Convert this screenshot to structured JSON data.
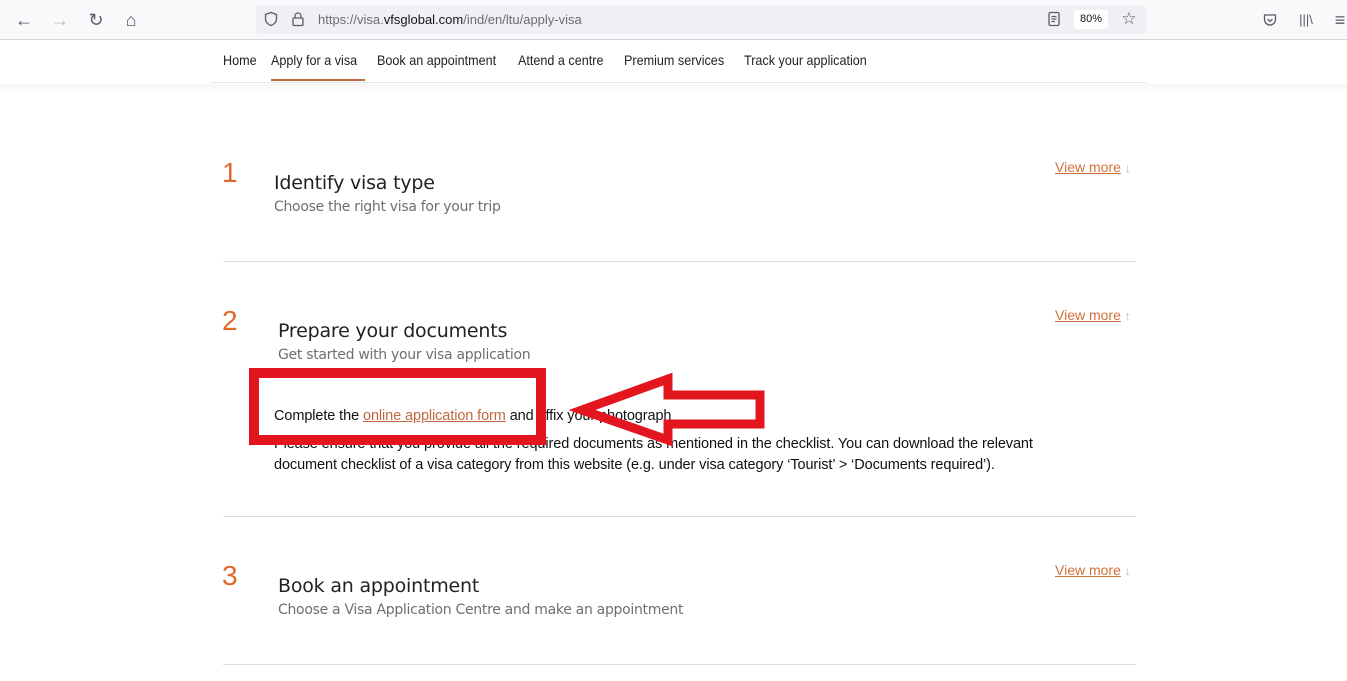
{
  "browser": {
    "url_prefix": "https://visa.",
    "url_domain": "vfsglobal.com",
    "url_path": "/ind/en/ltu/apply-visa",
    "zoom_level": "80%",
    "icons": {
      "back": "←",
      "forward": "→",
      "reload": "↻",
      "home": "⌂",
      "shield": "⛉",
      "lock": "🔒",
      "reader": "▤",
      "bookmark": "☆",
      "pocket": "⛉",
      "library": "|||\\",
      "menu": "≡"
    }
  },
  "nav": {
    "items": [
      {
        "label": "Home"
      },
      {
        "label": "Apply for a visa",
        "active": true
      },
      {
        "label": "Book an appointment"
      },
      {
        "label": "Attend a centre"
      },
      {
        "label": "Premium services"
      },
      {
        "label": "Track your application"
      }
    ],
    "accent_color": "#c0683f"
  },
  "steps": [
    {
      "number": "1",
      "title": "Identify visa type",
      "subtitle": "Choose the right visa for your trip",
      "view_more": "View more",
      "arrow": "↓"
    },
    {
      "number": "2",
      "title": "Prepare your documents",
      "subtitle": "Get started with your visa application",
      "view_more": "View more",
      "arrow": "↑",
      "content": {
        "line1_before": "Complete the ",
        "line1_link": "online application form",
        "line1_after": " and affix your photograph",
        "line2": "Please ensure that you provide all the required documents as mentioned in the checklist. You can download the relevant",
        "line3": "document checklist of a visa category from this website (e.g. under visa category ‘Tourist’ > ‘Documents required’)."
      }
    },
    {
      "number": "3",
      "title": "Book an appointment",
      "subtitle": "Choose a Visa Application Centre and make an appointment",
      "view_more": "View more",
      "arrow": "↓"
    }
  ],
  "annotation": {
    "color": "#e3161f"
  }
}
